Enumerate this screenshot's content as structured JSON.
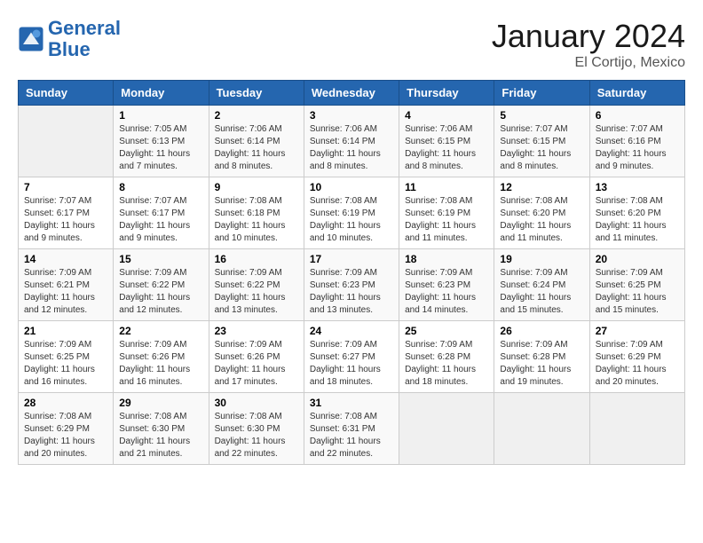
{
  "logo": {
    "line1": "General",
    "line2": "Blue"
  },
  "title": "January 2024",
  "subtitle": "El Cortijo, Mexico",
  "columns": [
    "Sunday",
    "Monday",
    "Tuesday",
    "Wednesday",
    "Thursday",
    "Friday",
    "Saturday"
  ],
  "weeks": [
    [
      {
        "day": "",
        "info": ""
      },
      {
        "day": "1",
        "info": "Sunrise: 7:05 AM\nSunset: 6:13 PM\nDaylight: 11 hours\nand 7 minutes."
      },
      {
        "day": "2",
        "info": "Sunrise: 7:06 AM\nSunset: 6:14 PM\nDaylight: 11 hours\nand 8 minutes."
      },
      {
        "day": "3",
        "info": "Sunrise: 7:06 AM\nSunset: 6:14 PM\nDaylight: 11 hours\nand 8 minutes."
      },
      {
        "day": "4",
        "info": "Sunrise: 7:06 AM\nSunset: 6:15 PM\nDaylight: 11 hours\nand 8 minutes."
      },
      {
        "day": "5",
        "info": "Sunrise: 7:07 AM\nSunset: 6:15 PM\nDaylight: 11 hours\nand 8 minutes."
      },
      {
        "day": "6",
        "info": "Sunrise: 7:07 AM\nSunset: 6:16 PM\nDaylight: 11 hours\nand 9 minutes."
      }
    ],
    [
      {
        "day": "7",
        "info": "Sunrise: 7:07 AM\nSunset: 6:17 PM\nDaylight: 11 hours\nand 9 minutes."
      },
      {
        "day": "8",
        "info": "Sunrise: 7:07 AM\nSunset: 6:17 PM\nDaylight: 11 hours\nand 9 minutes."
      },
      {
        "day": "9",
        "info": "Sunrise: 7:08 AM\nSunset: 6:18 PM\nDaylight: 11 hours\nand 10 minutes."
      },
      {
        "day": "10",
        "info": "Sunrise: 7:08 AM\nSunset: 6:19 PM\nDaylight: 11 hours\nand 10 minutes."
      },
      {
        "day": "11",
        "info": "Sunrise: 7:08 AM\nSunset: 6:19 PM\nDaylight: 11 hours\nand 11 minutes."
      },
      {
        "day": "12",
        "info": "Sunrise: 7:08 AM\nSunset: 6:20 PM\nDaylight: 11 hours\nand 11 minutes."
      },
      {
        "day": "13",
        "info": "Sunrise: 7:08 AM\nSunset: 6:20 PM\nDaylight: 11 hours\nand 11 minutes."
      }
    ],
    [
      {
        "day": "14",
        "info": "Sunrise: 7:09 AM\nSunset: 6:21 PM\nDaylight: 11 hours\nand 12 minutes."
      },
      {
        "day": "15",
        "info": "Sunrise: 7:09 AM\nSunset: 6:22 PM\nDaylight: 11 hours\nand 12 minutes."
      },
      {
        "day": "16",
        "info": "Sunrise: 7:09 AM\nSunset: 6:22 PM\nDaylight: 11 hours\nand 13 minutes."
      },
      {
        "day": "17",
        "info": "Sunrise: 7:09 AM\nSunset: 6:23 PM\nDaylight: 11 hours\nand 13 minutes."
      },
      {
        "day": "18",
        "info": "Sunrise: 7:09 AM\nSunset: 6:23 PM\nDaylight: 11 hours\nand 14 minutes."
      },
      {
        "day": "19",
        "info": "Sunrise: 7:09 AM\nSunset: 6:24 PM\nDaylight: 11 hours\nand 15 minutes."
      },
      {
        "day": "20",
        "info": "Sunrise: 7:09 AM\nSunset: 6:25 PM\nDaylight: 11 hours\nand 15 minutes."
      }
    ],
    [
      {
        "day": "21",
        "info": "Sunrise: 7:09 AM\nSunset: 6:25 PM\nDaylight: 11 hours\nand 16 minutes."
      },
      {
        "day": "22",
        "info": "Sunrise: 7:09 AM\nSunset: 6:26 PM\nDaylight: 11 hours\nand 16 minutes."
      },
      {
        "day": "23",
        "info": "Sunrise: 7:09 AM\nSunset: 6:26 PM\nDaylight: 11 hours\nand 17 minutes."
      },
      {
        "day": "24",
        "info": "Sunrise: 7:09 AM\nSunset: 6:27 PM\nDaylight: 11 hours\nand 18 minutes."
      },
      {
        "day": "25",
        "info": "Sunrise: 7:09 AM\nSunset: 6:28 PM\nDaylight: 11 hours\nand 18 minutes."
      },
      {
        "day": "26",
        "info": "Sunrise: 7:09 AM\nSunset: 6:28 PM\nDaylight: 11 hours\nand 19 minutes."
      },
      {
        "day": "27",
        "info": "Sunrise: 7:09 AM\nSunset: 6:29 PM\nDaylight: 11 hours\nand 20 minutes."
      }
    ],
    [
      {
        "day": "28",
        "info": "Sunrise: 7:08 AM\nSunset: 6:29 PM\nDaylight: 11 hours\nand 20 minutes."
      },
      {
        "day": "29",
        "info": "Sunrise: 7:08 AM\nSunset: 6:30 PM\nDaylight: 11 hours\nand 21 minutes."
      },
      {
        "day": "30",
        "info": "Sunrise: 7:08 AM\nSunset: 6:30 PM\nDaylight: 11 hours\nand 22 minutes."
      },
      {
        "day": "31",
        "info": "Sunrise: 7:08 AM\nSunset: 6:31 PM\nDaylight: 11 hours\nand 22 minutes."
      },
      {
        "day": "",
        "info": ""
      },
      {
        "day": "",
        "info": ""
      },
      {
        "day": "",
        "info": ""
      }
    ]
  ]
}
